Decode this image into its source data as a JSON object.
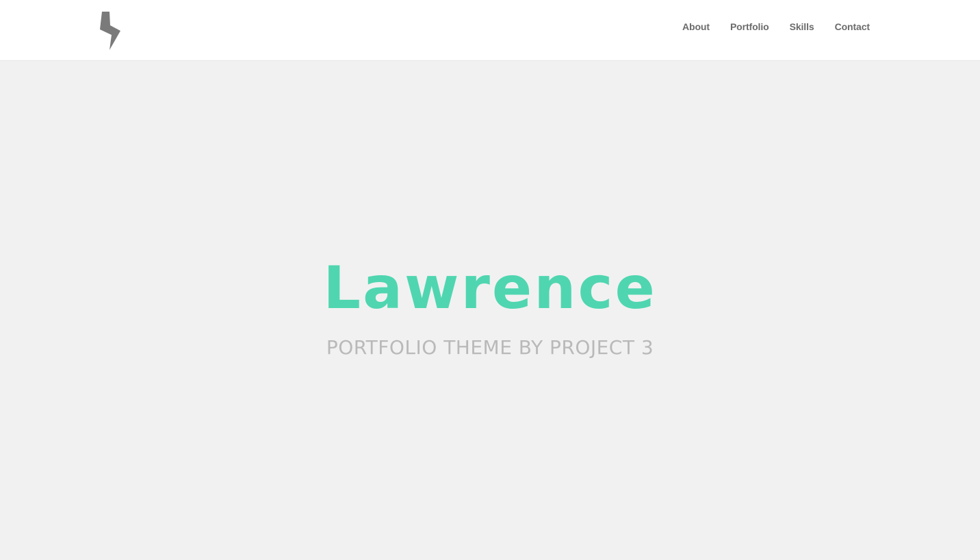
{
  "brand": {
    "logo_icon": "lightning-bolt-icon",
    "logo_color": "#7a7a7a"
  },
  "nav": {
    "items": [
      {
        "label": "About"
      },
      {
        "label": "Portfolio"
      },
      {
        "label": "Skills"
      },
      {
        "label": "Contact"
      }
    ]
  },
  "hero": {
    "title": "Lawrence",
    "subtitle": "PORTFOLIO THEME BY PROJECT 3"
  },
  "colors": {
    "accent": "#4fd6b0",
    "background": "#f1f1f1",
    "nav_text": "#6b6b6b",
    "subtitle_text": "#b9b9b9"
  }
}
